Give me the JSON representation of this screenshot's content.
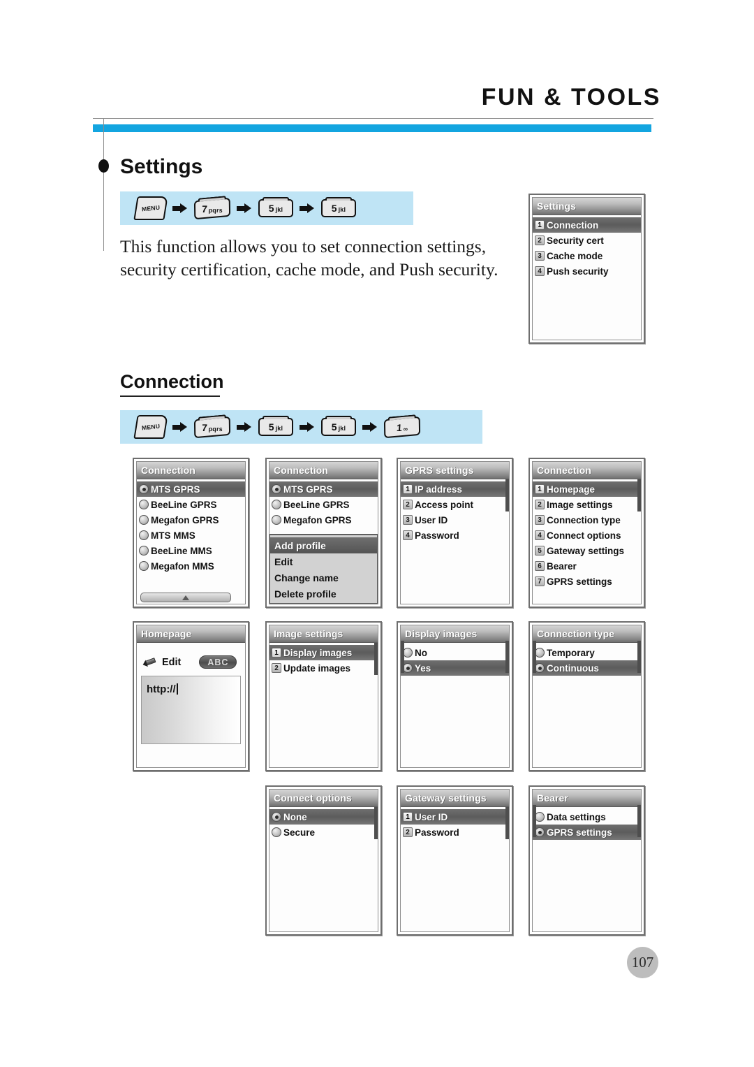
{
  "header": {
    "title": "FUN & TOOLS"
  },
  "section": {
    "title": "Settings",
    "body_text": "This function allows you to set connection settings, security certification, cache mode, and Push security."
  },
  "subsection": {
    "title": "Connection"
  },
  "key_sequences": {
    "settings": [
      {
        "main": "MENU",
        "sub": "",
        "style": "menu"
      },
      {
        "main": "7",
        "sub": "pqrs",
        "style": "tilt"
      },
      {
        "main": "5",
        "sub": "jkl",
        "style": "num"
      },
      {
        "main": "5",
        "sub": "jkl",
        "style": "num"
      }
    ],
    "connection": [
      {
        "main": "MENU",
        "sub": "",
        "style": "menu"
      },
      {
        "main": "7",
        "sub": "pqrs",
        "style": "tilt"
      },
      {
        "main": "5",
        "sub": "jkl",
        "style": "num"
      },
      {
        "main": "5",
        "sub": "jkl",
        "style": "num"
      },
      {
        "main": "1",
        "sub": "∞",
        "style": "tilt"
      }
    ]
  },
  "screens": {
    "settings": {
      "title": "Settings",
      "items": [
        {
          "num": "1",
          "label": "Connection",
          "selected": true
        },
        {
          "num": "2",
          "label": "Security cert",
          "selected": false
        },
        {
          "num": "3",
          "label": "Cache mode",
          "selected": false
        },
        {
          "num": "4",
          "label": "Push security",
          "selected": false
        }
      ]
    },
    "connection_profiles": {
      "title": "Connection",
      "items": [
        {
          "label": "MTS GPRS",
          "selected": true,
          "checked": true
        },
        {
          "label": "BeeLine GPRS",
          "selected": false,
          "checked": false
        },
        {
          "label": "Megafon GPRS",
          "selected": false,
          "checked": false
        },
        {
          "label": "MTS MMS",
          "selected": false,
          "checked": false
        },
        {
          "label": "BeeLine MMS",
          "selected": false,
          "checked": false
        },
        {
          "label": "Megafon MMS",
          "selected": false,
          "checked": false
        }
      ]
    },
    "connection_popup": {
      "title": "Connection",
      "items": [
        {
          "label": "MTS GPRS",
          "selected": true,
          "checked": true
        },
        {
          "label": "BeeLine GPRS",
          "selected": false,
          "checked": false
        },
        {
          "label": "Megafon GPRS",
          "selected": false,
          "checked": false
        }
      ],
      "popup": [
        {
          "label": "Add profile",
          "selected": true
        },
        {
          "label": "Edit",
          "selected": false
        },
        {
          "label": "Change name",
          "selected": false
        },
        {
          "label": "Delete profile",
          "selected": false
        }
      ]
    },
    "gprs_settings": {
      "title": "GPRS settings",
      "items": [
        {
          "num": "1",
          "label": "IP address",
          "selected": true
        },
        {
          "num": "2",
          "label": "Access point",
          "selected": false
        },
        {
          "num": "3",
          "label": "User ID",
          "selected": false
        },
        {
          "num": "4",
          "label": "Password",
          "selected": false
        }
      ]
    },
    "connection_menu": {
      "title": "Connection",
      "items": [
        {
          "num": "1",
          "label": "Homepage",
          "selected": true
        },
        {
          "num": "2",
          "label": "Image settings",
          "selected": false
        },
        {
          "num": "3",
          "label": "Connection type",
          "selected": false
        },
        {
          "num": "4",
          "label": "Connect options",
          "selected": false
        },
        {
          "num": "5",
          "label": "Gateway settings",
          "selected": false
        },
        {
          "num": "6",
          "label": "Bearer",
          "selected": false
        },
        {
          "num": "7",
          "label": "GPRS settings",
          "selected": false
        }
      ]
    },
    "homepage": {
      "title": "Homepage",
      "edit_label": "Edit",
      "input_mode_badge": "ABC",
      "url_value": "http://"
    },
    "image_settings": {
      "title": "Image settings",
      "items": [
        {
          "num": "1",
          "label": "Display images",
          "selected": true
        },
        {
          "num": "2",
          "label": "Update images",
          "selected": false
        }
      ]
    },
    "display_images": {
      "title": "Display images",
      "items": [
        {
          "label": "No",
          "selected": false,
          "checked": false
        },
        {
          "label": "Yes",
          "selected": true,
          "checked": true
        }
      ]
    },
    "connection_type": {
      "title": "Connection type",
      "items": [
        {
          "label": "Temporary",
          "selected": false,
          "checked": false
        },
        {
          "label": "Continuous",
          "selected": true,
          "checked": true
        }
      ]
    },
    "connect_options": {
      "title": "Connect options",
      "items": [
        {
          "label": "None",
          "selected": true,
          "checked": true
        },
        {
          "label": "Secure",
          "selected": false,
          "checked": false
        }
      ]
    },
    "gateway_settings": {
      "title": "Gateway settings",
      "items": [
        {
          "num": "1",
          "label": "User ID",
          "selected": true
        },
        {
          "num": "2",
          "label": "Password",
          "selected": false
        }
      ]
    },
    "bearer": {
      "title": "Bearer",
      "items": [
        {
          "label": "Data settings",
          "selected": false,
          "checked": false
        },
        {
          "label": "GPRS settings",
          "selected": true,
          "checked": true
        }
      ]
    }
  },
  "footer": {
    "page_number": "107"
  },
  "colors": {
    "accent_bar": "#13a5e0",
    "keystrip_bg": "#bfe4f5",
    "page_badge": "#bdbdbd"
  }
}
